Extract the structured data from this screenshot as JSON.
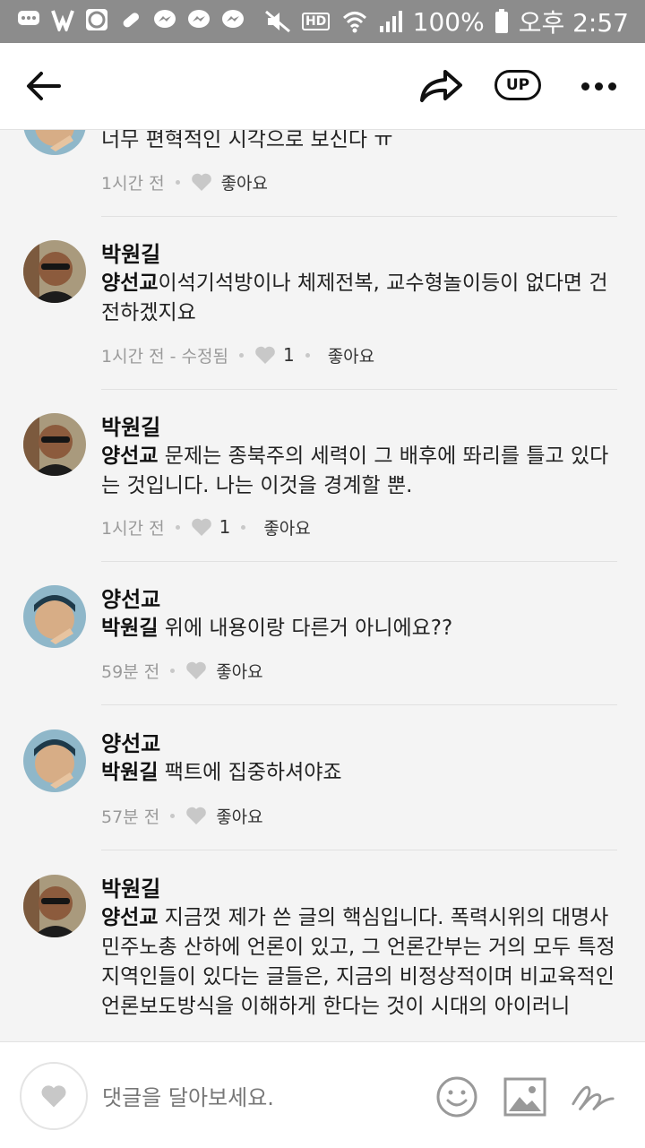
{
  "status_bar": {
    "battery": "100%",
    "time": "오후 2:57",
    "left_icons": [
      "chat-bubble-icon",
      "v-logo-icon",
      "s-box-icon",
      "pill-icon",
      "messenger-icon",
      "messenger-icon",
      "messenger-icon"
    ],
    "right_icons": [
      "mute-icon",
      "hd-icon",
      "wifi-icon",
      "signal-icon",
      "battery-icon"
    ],
    "hd_label": "HD"
  },
  "app_bar": {
    "up_label": "UP"
  },
  "comments": [
    {
      "text": "너무 편혁적인 시각으로 보신다 ㅠ",
      "time": "1시간 전",
      "like_label": "좋아요"
    },
    {
      "name": "박원길",
      "mention": "양선교",
      "text": "이석기석방이나 체제전복, 교수형놀이등이 없다면 건전하겠지요",
      "time": "1시간 전 - 수정됨",
      "like_count": "1",
      "like_label": "좋아요"
    },
    {
      "name": "박원길",
      "mention": "양선교",
      "text": " 문제는 종북주의 세력이 그 배후에 똬리를 틀고 있다는 것입니다. 나는 이것을 경계할 뿐.",
      "time": "1시간 전",
      "like_count": "1",
      "like_label": "좋아요"
    },
    {
      "name": "양선교",
      "mention": "박원길",
      "text": " 위에 내용이랑 다른거 아니에요??",
      "time": "59분 전",
      "like_label": "좋아요"
    },
    {
      "name": "양선교",
      "mention": "박원길",
      "text": " 팩트에 집중하셔야죠",
      "time": "57분 전",
      "like_label": "좋아요"
    },
    {
      "name": "박원길",
      "mention": "양선교",
      "text": " 지금껏 제가 쓴 글의 핵심입니다. 폭력시위의 대명사 민주노총 산하에 언론이 있고, 그 언론간부는 거의 모두 특정지역인들이 있다는 글들은, 지금의 비정상적이며 비교육적인 언론보도방식을 이해하게 한다는 것이 시대의 아이러니"
    }
  ],
  "comment_bar": {
    "placeholder": "댓글을 달아보세요."
  },
  "colors": {
    "status_bar_bg": "#8c8c8c",
    "page_bg": "#f4f4f4",
    "meta_text": "#9a9a9a",
    "heart_gray": "#c8c8c8"
  }
}
